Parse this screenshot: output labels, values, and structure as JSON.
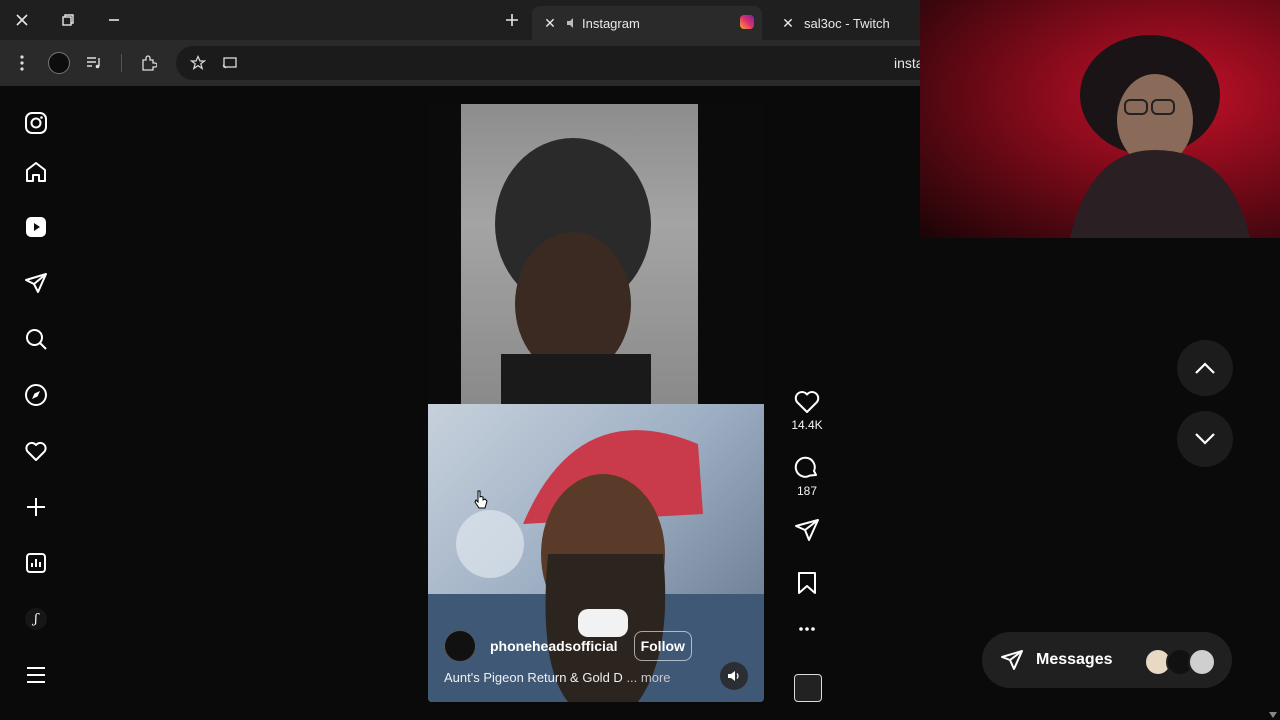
{
  "browser": {
    "tabs": [
      {
        "title": "Instagram"
      },
      {
        "title": "sal3oc - Twitch"
      }
    ],
    "address_fragment": "insta"
  },
  "sidebar": {
    "items": [
      {
        "icon": "instagram-logo-icon"
      },
      {
        "icon": "home-icon"
      },
      {
        "icon": "reels-icon"
      },
      {
        "icon": "direct-message-icon"
      },
      {
        "icon": "search-icon"
      },
      {
        "icon": "explore-icon"
      },
      {
        "icon": "notifications-icon"
      },
      {
        "icon": "create-icon"
      },
      {
        "icon": "dashboard-icon"
      },
      {
        "icon": "threads-icon"
      },
      {
        "icon": "more-menu-icon"
      }
    ]
  },
  "reel": {
    "author": "phoneheadsofficial",
    "follow_label": "Follow",
    "caption": "Aunt's Pigeon Return & Gold D",
    "caption_more": "... more",
    "likes": "14.4K",
    "comments": "187"
  },
  "messages": {
    "label": "Messages"
  },
  "colors": {
    "background": "#000000",
    "chrome_dark": "#1f1f1f",
    "accent_instagram": "#e1306c",
    "webcam_red": "#c4102a"
  }
}
